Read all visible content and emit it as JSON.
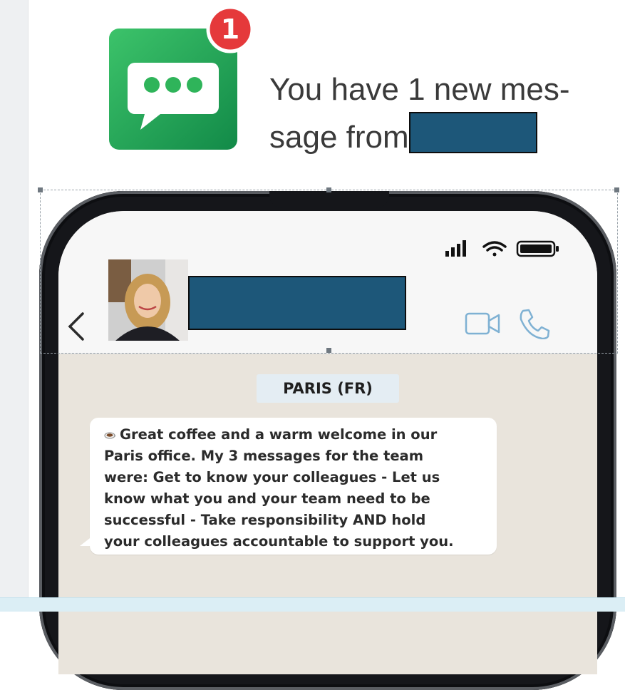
{
  "notification": {
    "badge_count": "1",
    "line1": "You have 1 new mes-",
    "line2": "sage from",
    "icon": "chat-bubble-dots-icon"
  },
  "phone": {
    "status_icons": [
      "signal-bars-icon",
      "wifi-icon",
      "battery-icon"
    ],
    "header": {
      "back_icon": "chevron-left-icon",
      "contact_icons": [
        "video-camera-icon",
        "phone-icon"
      ]
    },
    "chat": {
      "location_label": "PARIS (FR)",
      "message_lines": [
        "Great coffee and a warm welcome in our",
        "Paris office. My 3 messages for the team",
        "were: Get to know your colleagues - Let us",
        "know what you and your team need to be",
        "successful - Take responsibility AND hold",
        "your colleagues accountable to support you."
      ],
      "message_icon": "coffee-cup-icon"
    }
  },
  "colors": {
    "app_icon_green": "#2fb45a",
    "badge_red": "#e5393b",
    "redaction_blue": "#1d5779",
    "chat_background": "#e9e4dc",
    "ios_blue": "#7fb1d3"
  }
}
